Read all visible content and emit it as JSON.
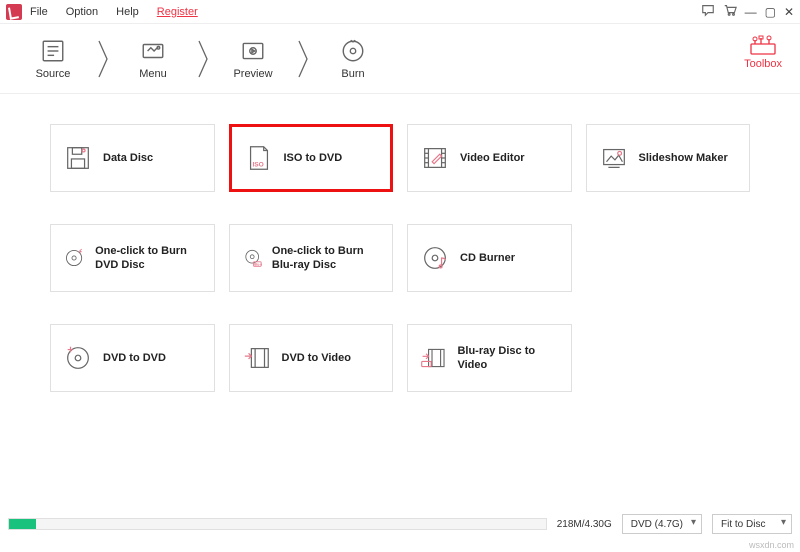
{
  "menu": {
    "file": "File",
    "option": "Option",
    "help": "Help",
    "register": "Register"
  },
  "steps": {
    "source": "Source",
    "menu": "Menu",
    "preview": "Preview",
    "burn": "Burn",
    "toolbox": "Toolbox"
  },
  "tiles": {
    "data_disc": "Data Disc",
    "iso_to_dvd": "ISO to DVD",
    "video_editor": "Video Editor",
    "slideshow_maker": "Slideshow Maker",
    "one_click_dvd": "One-click to Burn DVD Disc",
    "one_click_bluray": "One-click to Burn Blu-ray Disc",
    "cd_burner": "CD Burner",
    "dvd_to_dvd": "DVD to DVD",
    "dvd_to_video": "DVD to Video",
    "bluray_to_video": "Blu-ray Disc to Video"
  },
  "bottom": {
    "usage": "218M/4.30G",
    "disc": "DVD (4.7G)",
    "fit": "Fit to Disc"
  },
  "watermark": "wsxdn.com"
}
